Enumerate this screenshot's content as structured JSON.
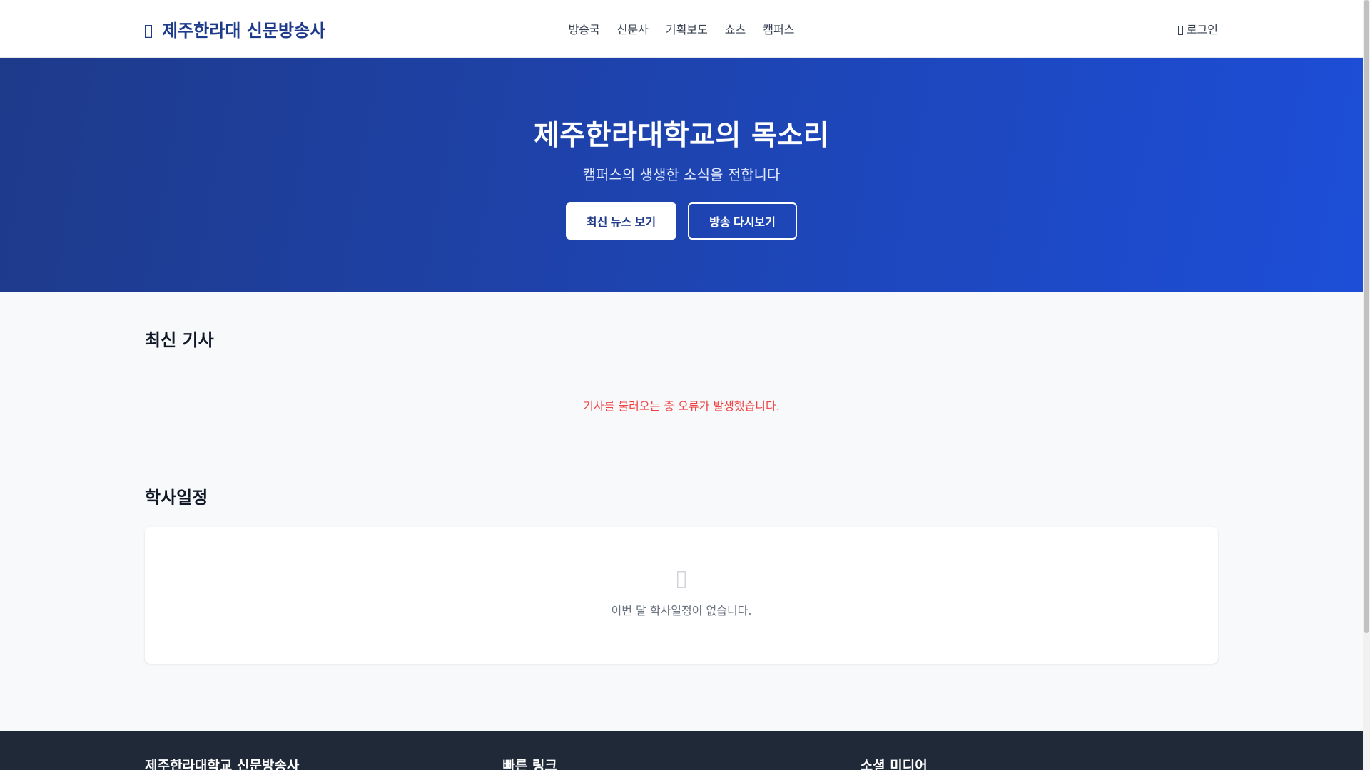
{
  "header": {
    "brand_icon": "broadcast-icon",
    "brand": "제주한라대 신문방송사",
    "nav": [
      "방송국",
      "신문사",
      "기획보도",
      "쇼츠",
      "캠퍼스"
    ],
    "login_icon": "sign-in-icon",
    "login": "로그인"
  },
  "hero": {
    "title": "제주한라대학교의 목소리",
    "subtitle": "캠퍼스의 생생한 소식을 전합니다",
    "primary_button": "최신 뉴스 보기",
    "secondary_button": "방송 다시보기"
  },
  "news": {
    "title": "최신 기사",
    "error": "기사를 불러오는 중 오류가 발생했습니다."
  },
  "schedule": {
    "title": "학사일정",
    "empty_icon": "calendar-icon",
    "empty": "이번 달 학사일정이 없습니다."
  },
  "footer": {
    "columns": [
      "제주한라대학교 신문방송사",
      "빠른 링크",
      "소셜 미디어"
    ]
  },
  "colors": {
    "brand": "#1e3a8a",
    "hero_start": "#1e3a8a",
    "hero_end": "#1d4ed8",
    "error": "#ef4444",
    "footer": "#1f2937"
  }
}
